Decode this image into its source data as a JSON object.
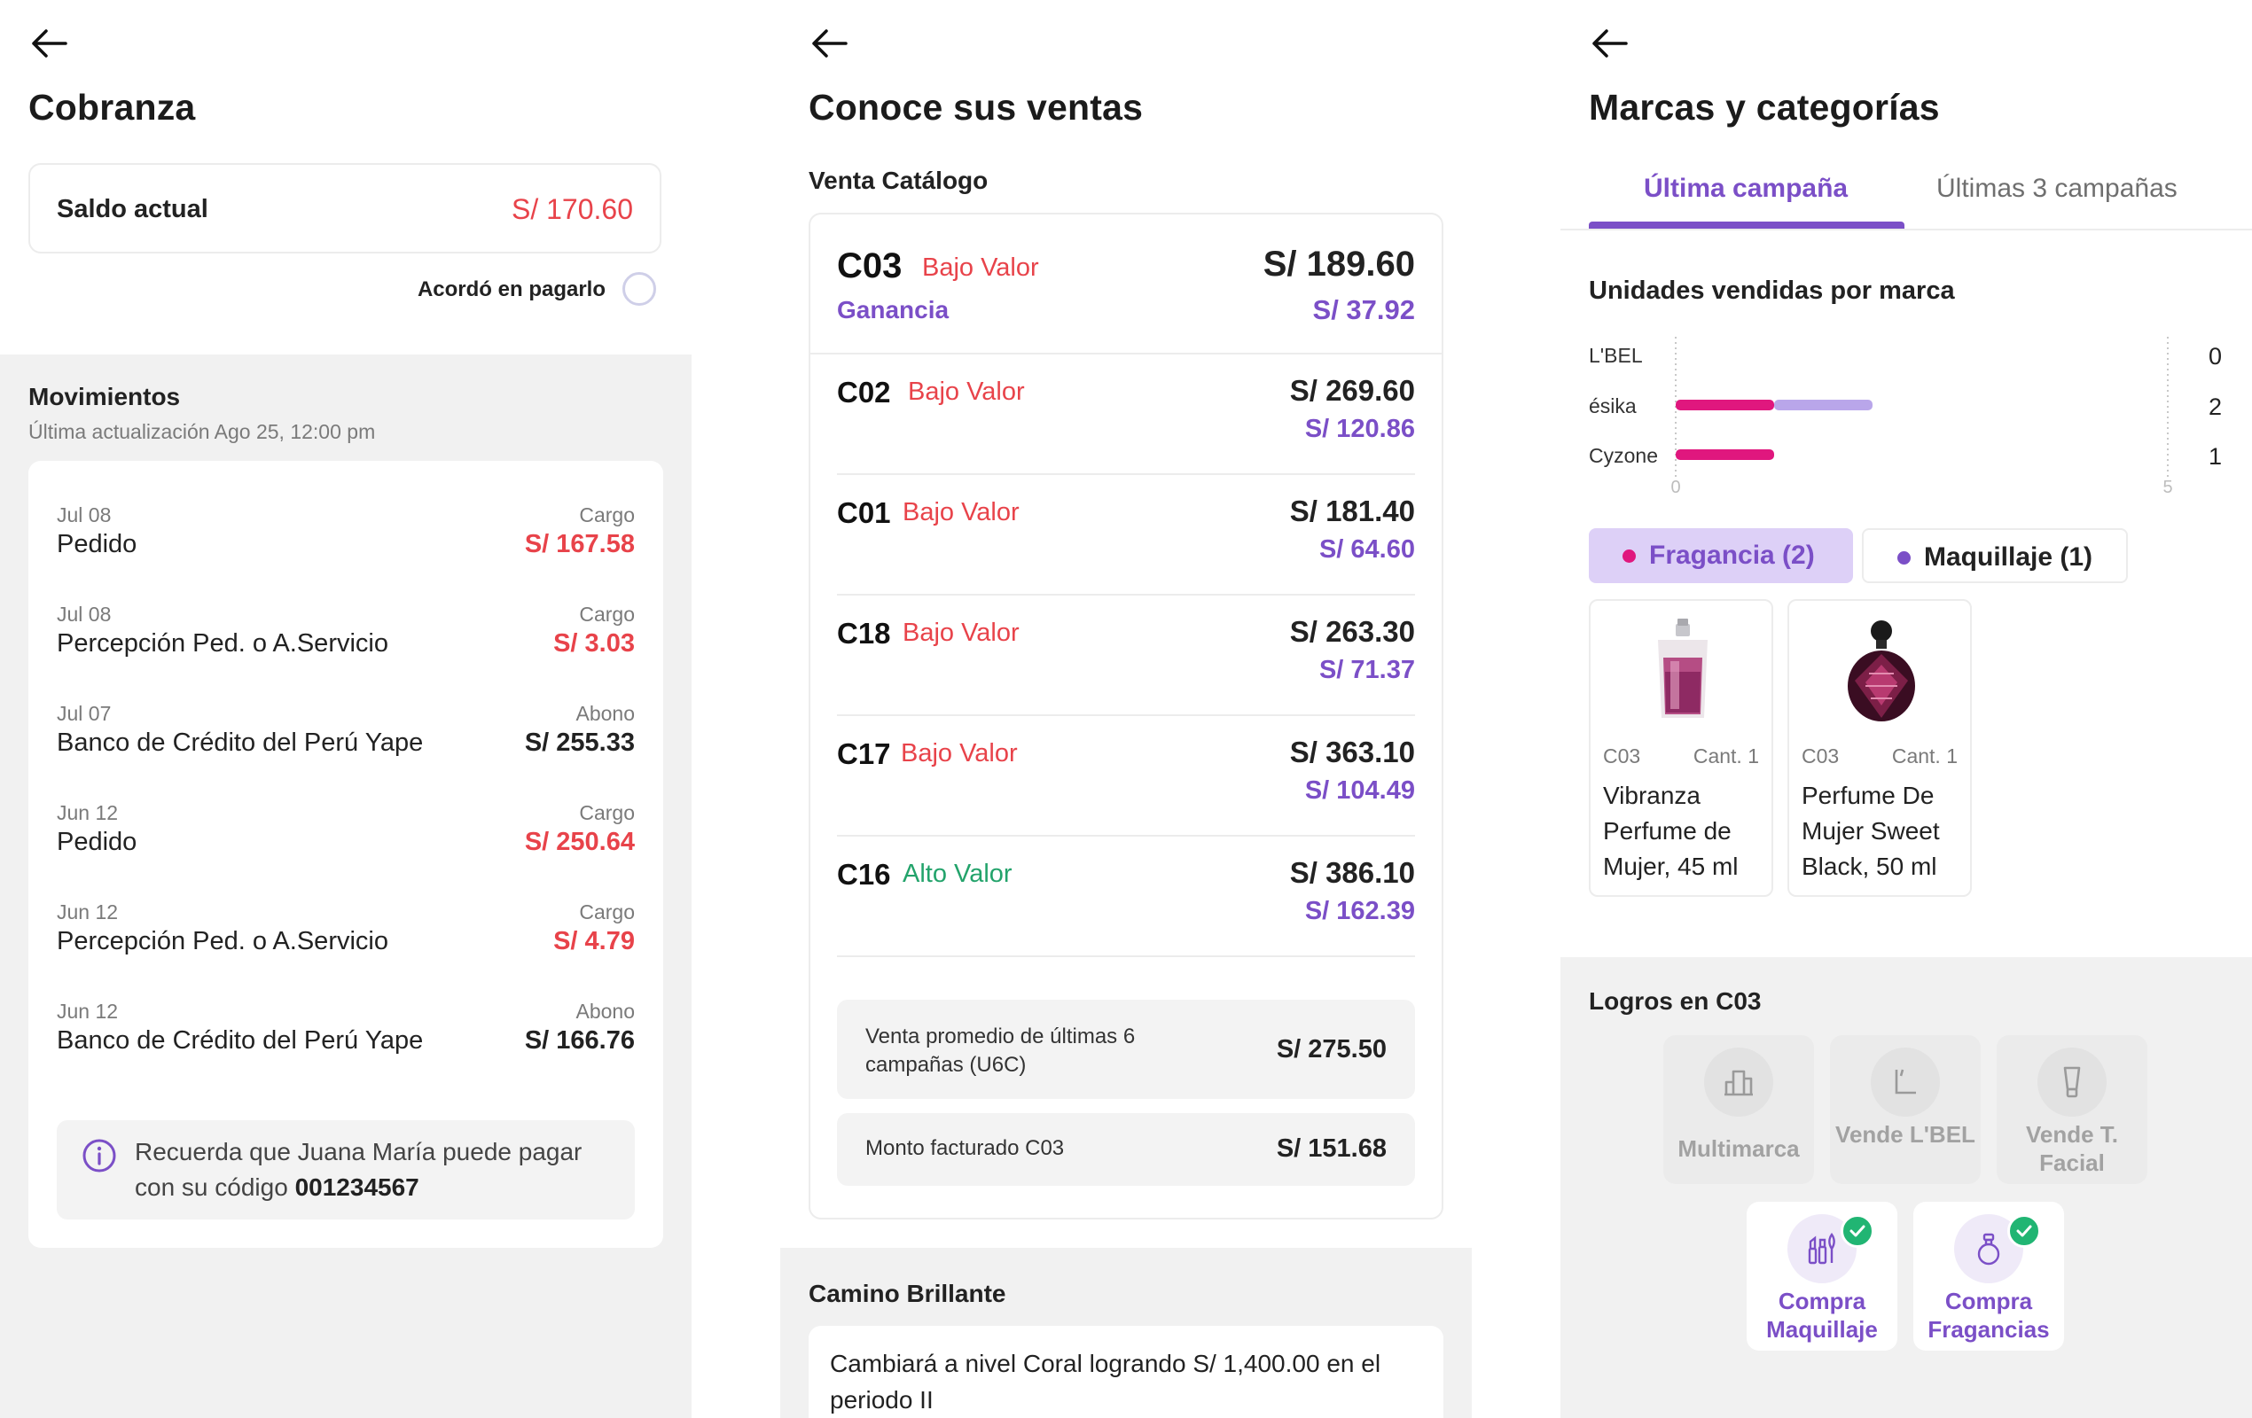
{
  "cobranza": {
    "title": "Cobranza",
    "saldo_label": "Saldo actual",
    "saldo_value": "S/ 170.60",
    "acordo_label": "Acordó en pagarlo",
    "movimientos_title": "Movimientos",
    "movimientos_sub": "Última actualización Ago 25, 12:00 pm",
    "rows": [
      {
        "date": "Jul 08",
        "name": "Pedido",
        "type": "Cargo",
        "amount": "S/ 167.58"
      },
      {
        "date": "Jul 08",
        "name": "Percepción Ped. o A.Servicio",
        "type": "Cargo",
        "amount": "S/ 3.03"
      },
      {
        "date": "Jul 07",
        "name": "Banco de Crédito del Perú Yape",
        "type": "Abono",
        "amount": "S/ 255.33"
      },
      {
        "date": "Jun 12",
        "name": "Pedido",
        "type": "Cargo",
        "amount": "S/ 250.64"
      },
      {
        "date": "Jun 12",
        "name": "Percepción Ped. o A.Servicio",
        "type": "Cargo",
        "amount": "S/ 4.79"
      },
      {
        "date": "Jun 12",
        "name": "Banco de Crédito del Perú Yape",
        "type": "Abono",
        "amount": "S/ 166.76"
      }
    ],
    "info_text": "Recuerda que Juana María puede pagar con su código",
    "info_code": "001234567"
  },
  "ventas": {
    "title": "Conoce sus ventas",
    "section_label": "Venta Catálogo",
    "current": {
      "code": "C03",
      "level": "Bajo Valor",
      "amount": "S/ 189.60",
      "ganancia_label": "Ganancia",
      "ganancia": "S/ 37.92"
    },
    "rows": [
      {
        "code": "C02",
        "level": "Bajo Valor",
        "amount": "S/ 269.60",
        "ganancia": "S/ 120.86"
      },
      {
        "code": "C01",
        "level": "Bajo Valor",
        "amount": "S/ 181.40",
        "ganancia": "S/ 64.60"
      },
      {
        "code": "C18",
        "level": "Bajo Valor",
        "amount": "S/ 263.30",
        "ganancia": "S/ 71.37"
      },
      {
        "code": "C17",
        "level": "Bajo Valor",
        "amount": "S/ 363.10",
        "ganancia": "S/ 104.49"
      },
      {
        "code": "C16",
        "level": "Alto Valor",
        "amount": "S/ 386.10",
        "ganancia": "S/ 162.39"
      }
    ],
    "promedio_label": "Venta promedio de últimas 6 campañas (U6C)",
    "promedio_value": "S/ 275.50",
    "facturado_label": "Monto facturado C03",
    "facturado_value": "S/ 151.68",
    "camino_title": "Camino Brillante",
    "camino_text": "Cambiará a nivel Coral logrando S/ 1,400.00 en el periodo II"
  },
  "marcas": {
    "title": "Marcas y categorías",
    "tabs": [
      "Última campaña",
      "Últimas 3 campañas"
    ],
    "chart_title": "Unidades vendidas por marca",
    "categories": [
      {
        "label": "Fragancia (2)",
        "color": "#e0177e"
      },
      {
        "label": "Maquillaje (1)",
        "color": "#7b4fc7"
      }
    ],
    "products": [
      {
        "code": "C03",
        "qty": "Cant. 1",
        "name": "Vibranza Perfume de Mujer, 45 ml"
      },
      {
        "code": "C03",
        "qty": "Cant. 1",
        "name": "Perfume De Mujer Sweet Black, 50 ml"
      }
    ],
    "logros_title": "Logros en C03",
    "achievements": [
      {
        "label": "Multimarca",
        "icon": "bar-chart-icon",
        "done": false
      },
      {
        "label": "Vende L'BEL",
        "icon": "lbel-logo-icon",
        "done": false
      },
      {
        "label": "Vende T. Facial",
        "icon": "cream-tube-icon",
        "done": false
      },
      {
        "label": "Compra Maquillaje",
        "icon": "makeup-icon",
        "done": true
      },
      {
        "label": "Compra Fragancias",
        "icon": "perfume-bottle-icon",
        "done": true
      }
    ]
  },
  "chart_data": {
    "type": "bar",
    "title": "Unidades vendidas por marca",
    "categories": [
      "L'BEL",
      "ésika",
      "Cyzone"
    ],
    "values": [
      0,
      2,
      1
    ],
    "series": [
      {
        "values": [
          0,
          1,
          1
        ],
        "color": "#e0177e"
      },
      {
        "values": [
          0,
          1,
          0
        ],
        "color": "#b9a6ea"
      }
    ],
    "xlim": [
      0,
      5
    ],
    "x_ticks": [
      "0",
      "5"
    ],
    "orientation": "horizontal"
  },
  "colors": {
    "accent": "#7b4fc7",
    "red": "#e8434a",
    "green": "#23a36b",
    "magenta": "#e0177e"
  }
}
